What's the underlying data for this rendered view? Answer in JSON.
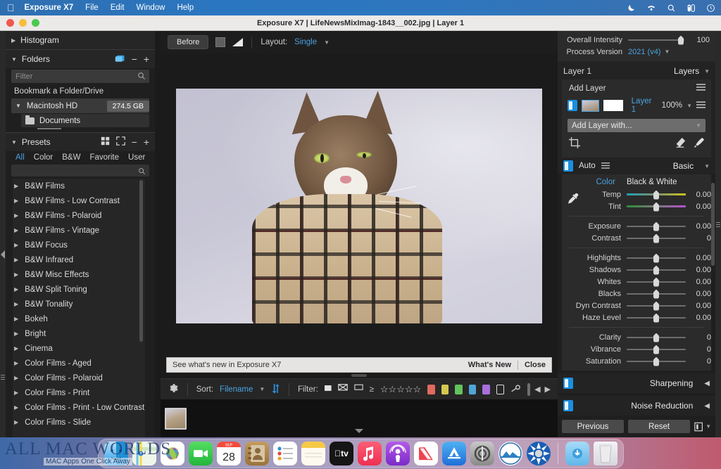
{
  "menubar": {
    "apple_icon": "apple-icon",
    "items": [
      {
        "label": "Exposure X7",
        "bold": true
      },
      {
        "label": "File",
        "bold": false
      },
      {
        "label": "Edit",
        "bold": false
      },
      {
        "label": "Window",
        "bold": false
      },
      {
        "label": "Help",
        "bold": false
      }
    ],
    "status_icons": [
      "moon-icon",
      "wifi-icon",
      "search-icon",
      "control-center-icon",
      "siri-icon"
    ]
  },
  "window": {
    "title": "Exposure X7 | LifeNewsMixImag-1843__002.jpg | Layer 1",
    "traffic_lights": [
      "close-button",
      "minimize-button",
      "zoom-button"
    ]
  },
  "left_panel": {
    "histogram": {
      "title": "Histogram",
      "expanded": false
    },
    "folders": {
      "title": "Folders",
      "expanded": true,
      "filter_placeholder": "Filter",
      "bookmark_label": "Bookmark a Folder/Drive",
      "drive": {
        "name": "Macintosh HD",
        "size": "274.5 GB"
      },
      "child": "Documents"
    },
    "presets": {
      "title": "Presets",
      "expanded": true,
      "tabs": [
        {
          "label": "All",
          "active": true
        },
        {
          "label": "Color",
          "active": false
        },
        {
          "label": "B&W",
          "active": false
        },
        {
          "label": "Favorite",
          "active": false
        },
        {
          "label": "User",
          "active": false
        }
      ],
      "items": [
        "B&W Films",
        "B&W Films - Low Contrast",
        "B&W Films - Polaroid",
        "B&W Films - Vintage",
        "B&W Focus",
        "B&W Infrared",
        "B&W Misc Effects",
        "B&W Split Toning",
        "B&W Tonality",
        "Bokeh",
        "Bright",
        "Cinema",
        "Color Films - Aged",
        "Color Films - Polaroid",
        "Color Films - Print",
        "Color Films - Print - Low Contrast",
        "Color Films - Slide"
      ]
    }
  },
  "view_toolbar": {
    "before_label": "Before",
    "swatch_icons": [
      "background-swatch-icon",
      "gradient-swatch-icon"
    ],
    "layout_label": "Layout:",
    "layout_value": "Single"
  },
  "notice_bar": {
    "message": "See what's new in Exposure X7",
    "whats_new_label": "What's New",
    "close_label": "Close"
  },
  "filter_bar": {
    "gear_icon": "gear-icon",
    "sort_label": "Sort:",
    "sort_value": "Filename",
    "sort_direction_icon": "sort-direction-icon",
    "filter_label": "Filter:",
    "flag_icons": [
      "flag-picked-icon",
      "flag-rejected-icon",
      "flag-unflagged-icon"
    ],
    "rating_prefix": "≥",
    "star_count": 5,
    "color_chips": [
      "#e06a5e",
      "#d4c84f",
      "#62c35c",
      "#4fa6d8",
      "#a96fdd"
    ],
    "color_chip_outline": "#dcdcdc",
    "keyword_icon": "keyword-icon",
    "nav_icons": [
      "prev-arrow-icon",
      "next-arrow-icon"
    ]
  },
  "right_panel": {
    "overall_intensity": {
      "label": "Overall Intensity",
      "value": "100"
    },
    "process_version": {
      "label": "Process Version",
      "value": "2021 (v4)"
    },
    "layers_header": {
      "left": "Layer 1",
      "right": "Layers"
    },
    "add_layer_label": "Add Layer",
    "layer_row": {
      "name": "Layer 1",
      "opacity": "100%"
    },
    "add_layer_with_label": "Add Layer with...",
    "tools": [
      "crop-icon",
      "eraser-icon",
      "brush-icon"
    ],
    "basic": {
      "auto_label": "Auto",
      "panel_label": "Basic",
      "mode_color": "Color",
      "mode_bw": "Black & White",
      "sliders": [
        {
          "label": "Temp",
          "value": "0.00",
          "track": "temp"
        },
        {
          "label": "Tint",
          "value": "0.00",
          "track": "tint"
        },
        {
          "label": "Exposure",
          "value": "0.00",
          "track": "plain"
        },
        {
          "label": "Contrast",
          "value": "0",
          "track": "plain"
        },
        {
          "label": "Highlights",
          "value": "0.00",
          "track": "plain"
        },
        {
          "label": "Shadows",
          "value": "0.00",
          "track": "plain"
        },
        {
          "label": "Whites",
          "value": "0.00",
          "track": "plain"
        },
        {
          "label": "Blacks",
          "value": "0.00",
          "track": "plain"
        },
        {
          "label": "Dyn Contrast",
          "value": "0.00",
          "track": "plain"
        },
        {
          "label": "Haze Level",
          "value": "0.00",
          "track": "plain"
        },
        {
          "label": "Clarity",
          "value": "0",
          "track": "plain"
        },
        {
          "label": "Vibrance",
          "value": "0",
          "track": "plain"
        },
        {
          "label": "Saturation",
          "value": "0",
          "track": "plain"
        }
      ]
    },
    "sharpening_label": "Sharpening",
    "noise_reduction_label": "Noise Reduction",
    "previous_label": "Previous",
    "reset_label": "Reset"
  },
  "dock": {
    "items": [
      {
        "name": "finder",
        "color": "#2b9fe8"
      },
      {
        "name": "maps",
        "color": "#e8f3e4"
      },
      {
        "name": "photos",
        "color": "#ffffff"
      },
      {
        "name": "facetime",
        "color": "#37c84a"
      },
      {
        "name": "calendar",
        "color": "#ffffff",
        "badge": "28",
        "month": "SEP"
      },
      {
        "name": "contacts",
        "color": "#b08a4e"
      },
      {
        "name": "reminders",
        "color": "#ffffff"
      },
      {
        "name": "notes",
        "color": "#fdf3cf"
      },
      {
        "name": "apple-tv",
        "color": "#1b1b1b"
      },
      {
        "name": "music",
        "color": "#f4455e"
      },
      {
        "name": "podcasts",
        "color": "#9b3fd6"
      },
      {
        "name": "news",
        "color": "#ffffff"
      },
      {
        "name": "app-store",
        "color": "#2e8ae5"
      },
      {
        "name": "system-preferences",
        "color": "#9a9a9a"
      },
      {
        "name": "exposure-x7",
        "color": "#ffffff"
      },
      {
        "name": "alien-skin",
        "color": "#1a5fb4"
      }
    ],
    "right_items": [
      {
        "name": "downloads-folder",
        "color": "#79c6f2"
      },
      {
        "name": "trash",
        "color": "#e9e9ee"
      }
    ]
  },
  "watermark": {
    "title": "ALL MAC WORLDS",
    "subtitle": "MAC Apps One Click Away"
  }
}
